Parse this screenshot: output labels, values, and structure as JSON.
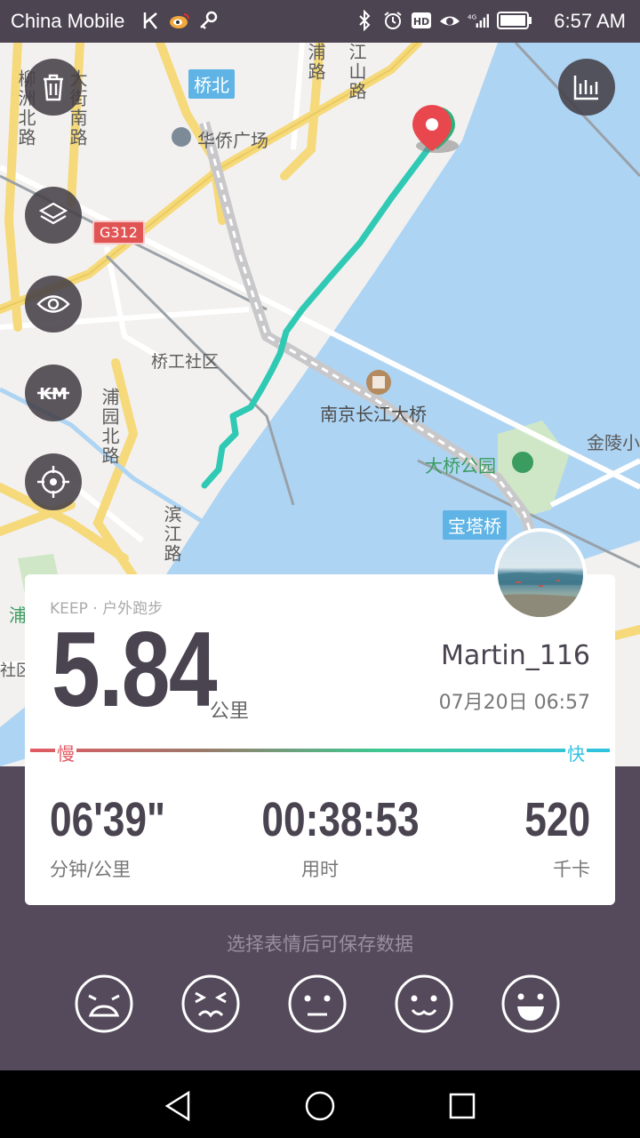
{
  "status_bar": {
    "carrier": "China Mobile",
    "time": "6:57 AM",
    "network": "4G"
  },
  "map": {
    "labels": {
      "qiaobei": "桥北",
      "huaqiao": "华侨广场",
      "g312": "G312",
      "qiaogong": "桥工社区",
      "bridge": "南京长江大桥",
      "park": "大桥公园",
      "pagoda_bridge": "宝塔桥",
      "jinling": "金陵小",
      "pujiang": "浦",
      "community": "社区",
      "zhujiang_rd": "江山路",
      "puyuan_rd": "浦园北路",
      "binjiang_rd": "滨江路",
      "liuzhou_rd": "柳洲北路",
      "dongjiang_rd": "大街南路",
      "pu_rd": "浦路"
    }
  },
  "card": {
    "source": "KEEP · 户外跑步",
    "distance": "5.84",
    "distance_unit": "公里",
    "username": "Martin_116",
    "datetime": "07月20日 06:57",
    "pace_slow": "慢",
    "pace_fast": "快",
    "stats": {
      "pace": "06'39\"",
      "pace_label": "分钟/公里",
      "duration": "00:38:53",
      "duration_label": "用时",
      "calories": "520",
      "calories_label": "千卡"
    }
  },
  "mood": {
    "hint": "选择表情后可保存数据"
  },
  "colors": {
    "panel_bg": "#544a5b",
    "route": "#2fc9b4",
    "slow": "#e25a63",
    "fast": "#2fc3e3",
    "text_dark": "#4a4350"
  }
}
